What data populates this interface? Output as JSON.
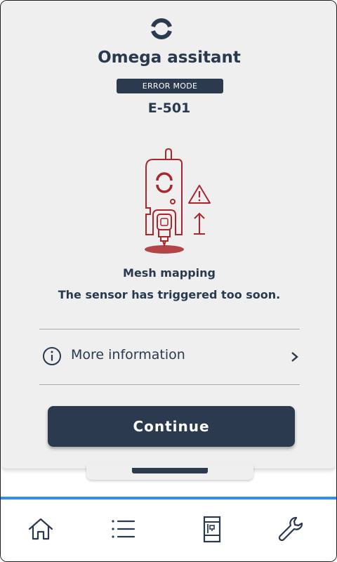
{
  "app": {
    "title": "Omega assitant",
    "mode_badge": "ERROR MODE",
    "error_code": "E-501"
  },
  "error": {
    "heading": "Mesh mapping",
    "message": "The sensor has triggered too soon."
  },
  "more_info": {
    "label": "More information"
  },
  "actions": {
    "continue_label": "Continue"
  },
  "navbar": {
    "items": [
      {
        "name": "home",
        "icon": "home-icon"
      },
      {
        "name": "list",
        "icon": "list-icon"
      },
      {
        "name": "printer",
        "icon": "printer-icon"
      },
      {
        "name": "tools",
        "icon": "wrench-icon"
      }
    ],
    "accent_color": "#2f8ff0"
  },
  "colors": {
    "primary": "#2b3a4f",
    "error": "#a8262c",
    "background": "#efefef"
  }
}
